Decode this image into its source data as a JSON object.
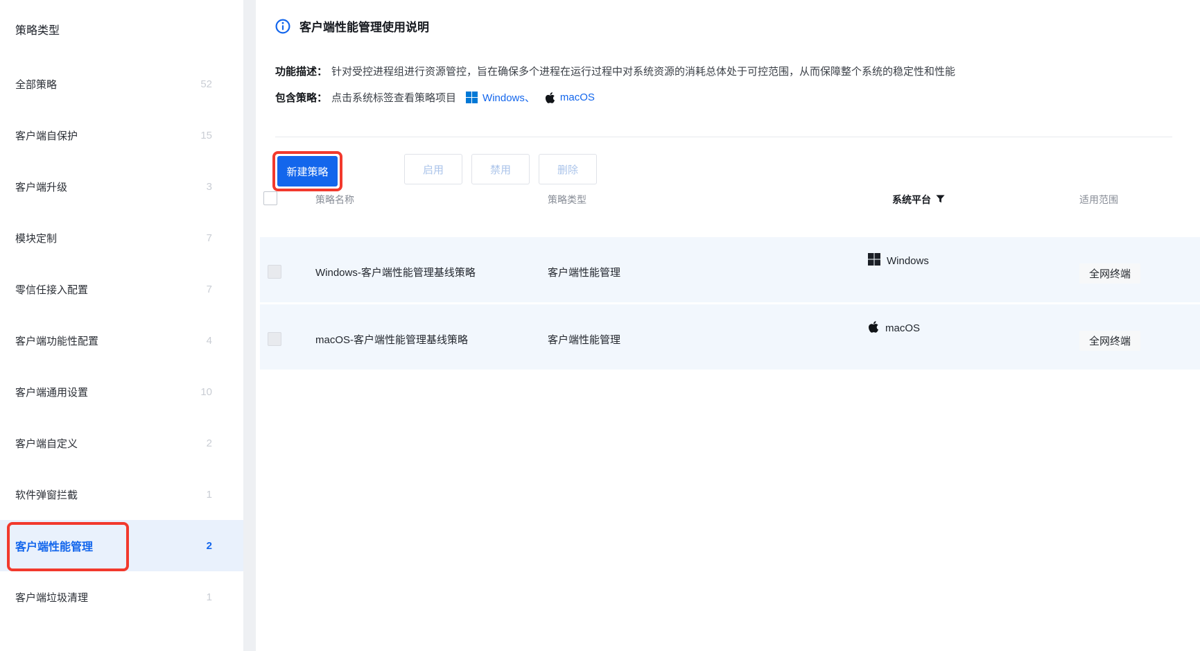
{
  "sidebar": {
    "header": "策略类型",
    "items": [
      {
        "label": "全部策略",
        "count": "52"
      },
      {
        "label": "客户端自保护",
        "count": "15"
      },
      {
        "label": "客户端升级",
        "count": "3"
      },
      {
        "label": "模块定制",
        "count": "7"
      },
      {
        "label": "零信任接入配置",
        "count": "7"
      },
      {
        "label": "客户端功能性配置",
        "count": "4"
      },
      {
        "label": "客户端通用设置",
        "count": "10"
      },
      {
        "label": "客户端自定义",
        "count": "2"
      },
      {
        "label": "软件弹窗拦截",
        "count": "1"
      },
      {
        "label": "客户端性能管理",
        "count": "2",
        "selected": true
      },
      {
        "label": "客户端垃圾清理",
        "count": "1"
      }
    ]
  },
  "usage": {
    "title": "客户端性能管理使用说明",
    "feature_label": "功能描述：",
    "feature_text": "针对受控进程组进行资源管控，旨在确保多个进程在运行过程中对系统资源的消耗总体处于可控范围，从而保障整个系统的稳定性和性能",
    "policies_label": "包含策略：",
    "policies_text": "点击系统标签查看策略项目",
    "windows_link": "Windows、",
    "macos_link": "macOS"
  },
  "toolbar": {
    "new_label": "新建策略",
    "enable_label": "启用",
    "disable_label": "禁用",
    "delete_label": "删除"
  },
  "table": {
    "headers": {
      "name": "策略名称",
      "type": "策略类型",
      "platform": "系统平台",
      "scope": "适用范围"
    },
    "rows": [
      {
        "name": "Windows-客户端性能管理基线策略",
        "type": "客户端性能管理",
        "platform": "Windows",
        "scope": "全网终端"
      },
      {
        "name": "macOS-客户端性能管理基线策略",
        "type": "客户端性能管理",
        "platform": "macOS",
        "scope": "全网终端"
      }
    ]
  },
  "colors": {
    "accent_blue": "#1366ec",
    "annotation_red": "#f2392d",
    "windows_logo_blue": "#0078d6",
    "row_background": "#f2f7fd",
    "selected_item_background": "#e9f1fc"
  }
}
